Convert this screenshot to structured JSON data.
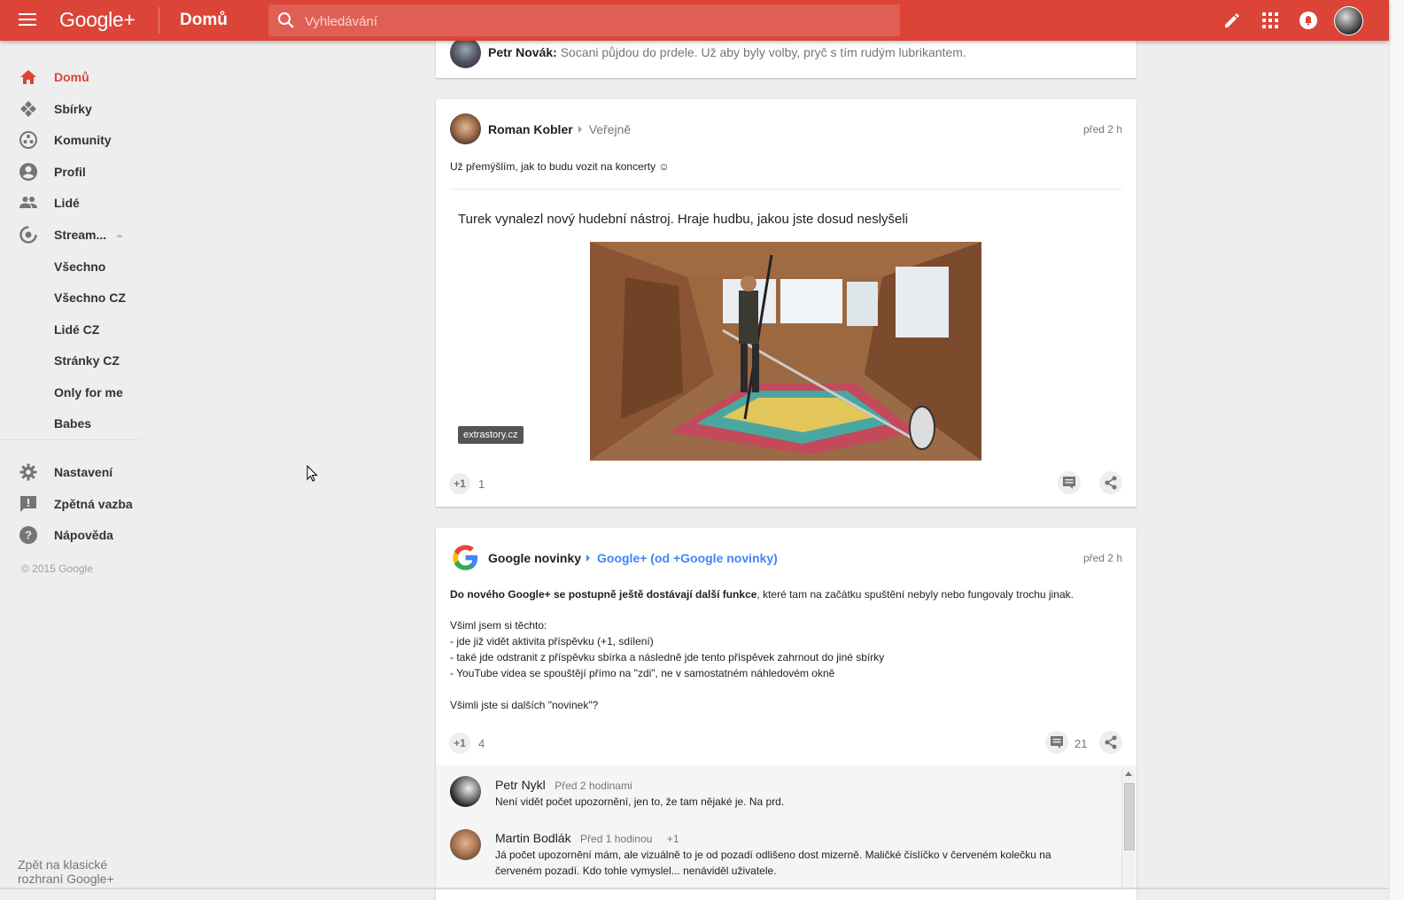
{
  "topbar": {
    "logo": "Google+",
    "title": "Domů",
    "search_placeholder": "Vyhledávání"
  },
  "sidebar": {
    "items": [
      {
        "label": "Domů",
        "icon": "home-icon",
        "active": true
      },
      {
        "label": "Sbírky",
        "icon": "collections-icon"
      },
      {
        "label": "Komunity",
        "icon": "communities-icon"
      },
      {
        "label": "Profil",
        "icon": "profile-icon"
      },
      {
        "label": "Lidé",
        "icon": "people-icon"
      },
      {
        "label": "Stream...",
        "icon": "stream-icon"
      }
    ],
    "sub_items": [
      "Všechno",
      "Všechno CZ",
      "Lidé CZ",
      "Stránky CZ",
      "Only for me",
      "Babes"
    ],
    "bottom_items": [
      {
        "label": "Nastavení",
        "icon": "gear-icon"
      },
      {
        "label": "Zpětná vazba",
        "icon": "feedback-icon"
      },
      {
        "label": "Nápověda",
        "icon": "help-icon"
      }
    ],
    "copyright": "© 2015 Google",
    "classic_link": "Zpět na klasické rozhraní Google+"
  },
  "feed": {
    "partial_comment": {
      "author": "Petr Novák:",
      "text": "Socani půjdou do prdele. Už aby byly volby, pryč s tím rudým lubrikantem."
    },
    "post1": {
      "author": "Roman Kobler",
      "visibility": "Veřejně",
      "time": "před 2 h",
      "text": "Už přemýšlím, jak to budu vozit na koncerty ☺",
      "link_title": "Turek vynalezl nový hudební nástroj. Hraje hudbu, jakou jste dosud neslyšeli",
      "link_source": "extrastory.cz",
      "plus_label": "+1",
      "plus_count": "1"
    },
    "post2": {
      "author": "Google novinky",
      "target": "Google+ (od +Google novinky)",
      "time": "před 2 h",
      "text_bold": "Do nového Google+ se postupně ještě dostávají další funkce",
      "text_rest": ", které tam na začátku spuštění nebyly nebo fungovaly trochu jinak.",
      "line1": "Všiml jsem si těchto:",
      "line2": "- jde již vidět aktivita příspěvku (+1, sdílení)",
      "line3": "- také jde odstranit z příspěvku sbírka a následně jde tento příspěvek zahrnout do jiné sbírky",
      "line4": "- YouTube videa se spouštějí přímo na \"zdi\", ne v samostatném náhledovém okně",
      "line5": "Všimli jste si dalších \"novinek\"?",
      "plus_label": "+1",
      "plus_count": "4",
      "comment_count": "21",
      "comments": [
        {
          "author": "Petr Nykl",
          "time": "Před 2 hodinami",
          "plus": "",
          "text": "Není vidět počet upozornění, jen to, že tam nějaké je. Na prd."
        },
        {
          "author": "Martin Bodlák",
          "time": "Před 1 hodinou",
          "plus": "+1",
          "text": "Já počet upozornění mám, ale vizuálně to je od pozadí odlišeno dost mizerně. Maličké číslíčko v červeném kolečku na",
          "text2": "červeném pozadí. Kdo tohle vymyslel... nenáviděl uživatele."
        }
      ]
    }
  },
  "colors": {
    "accent": "#db4437",
    "link": "#4285f4",
    "background": "#eeeeee"
  }
}
